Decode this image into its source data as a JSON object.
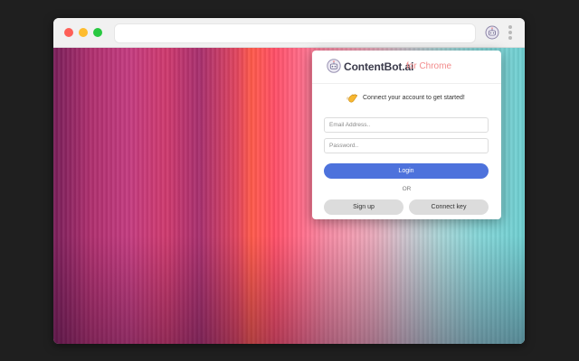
{
  "browser": {
    "extension_icon": "robot-icon",
    "menu_icon": "kebab-menu-icon"
  },
  "popup": {
    "brand_name": "ContentBot.ai",
    "brand_suffix": "for Chrome",
    "brand_color": "#f28b8b",
    "logo_icon": "robot-icon",
    "tagline_icon": "waving-hand-icon",
    "tagline": "Connect your account to get started!",
    "email_placeholder": "Email Address..",
    "password_placeholder": "Password..",
    "login_label": "Login",
    "login_color": "#4d72dc",
    "or_label": "OR",
    "signup_label": "Sign up",
    "connect_key_label": "Connect key"
  }
}
